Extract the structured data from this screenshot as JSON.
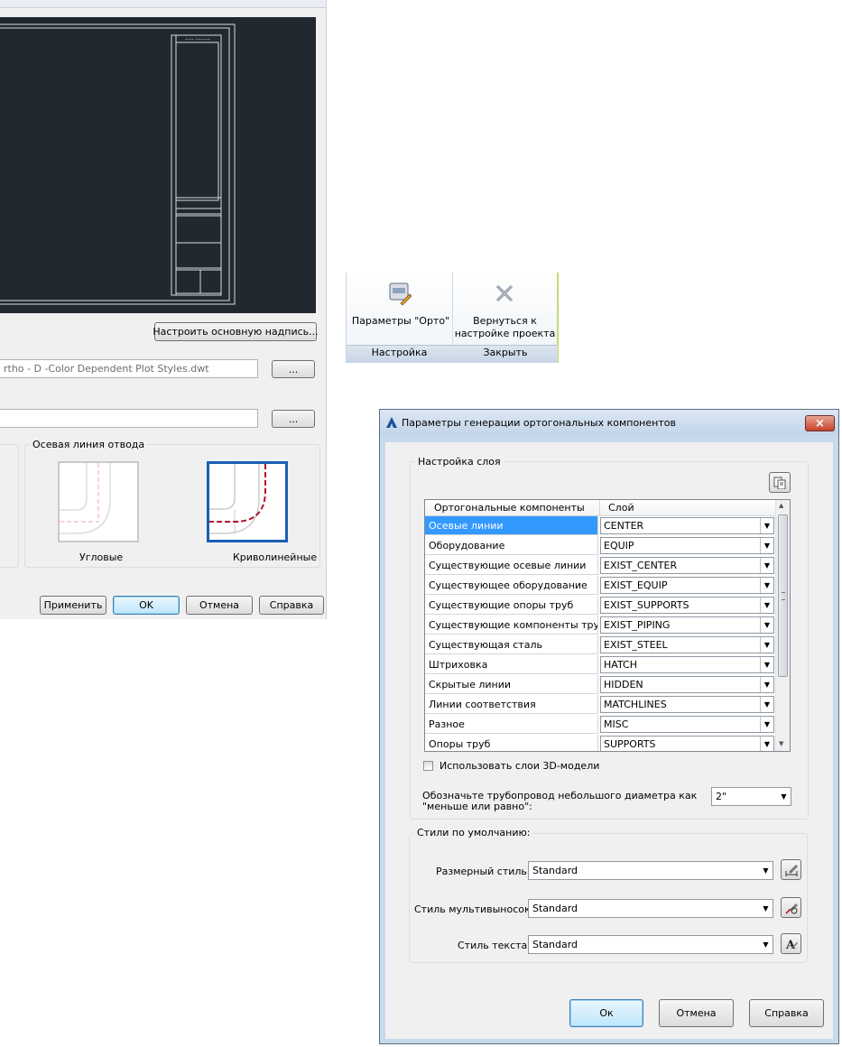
{
  "left_dialog": {
    "customize_title_block_button": "Настроить основную надпись...",
    "template_path": "rtho - D -Color Dependent Plot Styles.dwt",
    "browse_label": "...",
    "elbow_group_title": "Осевая линия отвода",
    "elbow_angular_label": "Угловые",
    "elbow_curved_label": "Криволинейные",
    "apply_button": "Применить",
    "ok_button": "OK",
    "cancel_button": "Отмена",
    "help_button": "Справка"
  },
  "ribbon": {
    "ortho_settings_label": "Параметры \"Орто\"",
    "return_label_1": "Вернуться к",
    "return_label_2": "настройке проекта",
    "panel_settings": "Настройка",
    "panel_close": "Закрыть"
  },
  "dialog": {
    "title": "Параметры генерации ортогональных компонентов",
    "close_label": "×",
    "layer_group_title": "Настройка слоя",
    "col_component": "Ортогональные компоненты",
    "col_layer": "Слой",
    "rows": [
      {
        "component": "Осевые линии",
        "layer": "CENTER"
      },
      {
        "component": "Оборудование",
        "layer": "EQUIP"
      },
      {
        "component": "Существующие осевые линии",
        "layer": "EXIST_CENTER"
      },
      {
        "component": "Существующее оборудование",
        "layer": "EXIST_EQUIP"
      },
      {
        "component": "Существующие опоры труб",
        "layer": "EXIST_SUPPORTS"
      },
      {
        "component": "Существующие компоненты трубо...",
        "layer": "EXIST_PIPING"
      },
      {
        "component": "Существующая сталь",
        "layer": "EXIST_STEEL"
      },
      {
        "component": "Штриховка",
        "layer": "HATCH"
      },
      {
        "component": "Скрытые линии",
        "layer": "HIDDEN"
      },
      {
        "component": "Линии соответствия",
        "layer": "MATCHLINES"
      },
      {
        "component": "Разное",
        "layer": "MISC"
      },
      {
        "component": "Опоры труб",
        "layer": "SUPPORTS"
      }
    ],
    "use_3d_layers_label": "Использовать слои 3D-модели",
    "use_3d_layers_checked": false,
    "small_bore_label_1": "Обозначьте трубопровод небольшого диаметра как",
    "small_bore_label_2": "\"меньше или равно\":",
    "small_bore_value": "2\"",
    "default_styles_title": "Стили по умолчанию:",
    "dim_style_label": "Размерный стиль:",
    "dim_style_value": "Standard",
    "mleader_style_label": "Стиль мультивыносок:",
    "mleader_style_value": "Standard",
    "text_style_label": "Стиль текста:",
    "text_style_value": "Standard",
    "ok_button": "Ок",
    "cancel_button": "Отмена",
    "help_button": "Справка"
  },
  "colors": {
    "canvas_bg": "#212830",
    "selection": "#3399ff",
    "elbow_selected_border": "#1a5fb4",
    "elbow_centerline": "#b0102a"
  }
}
